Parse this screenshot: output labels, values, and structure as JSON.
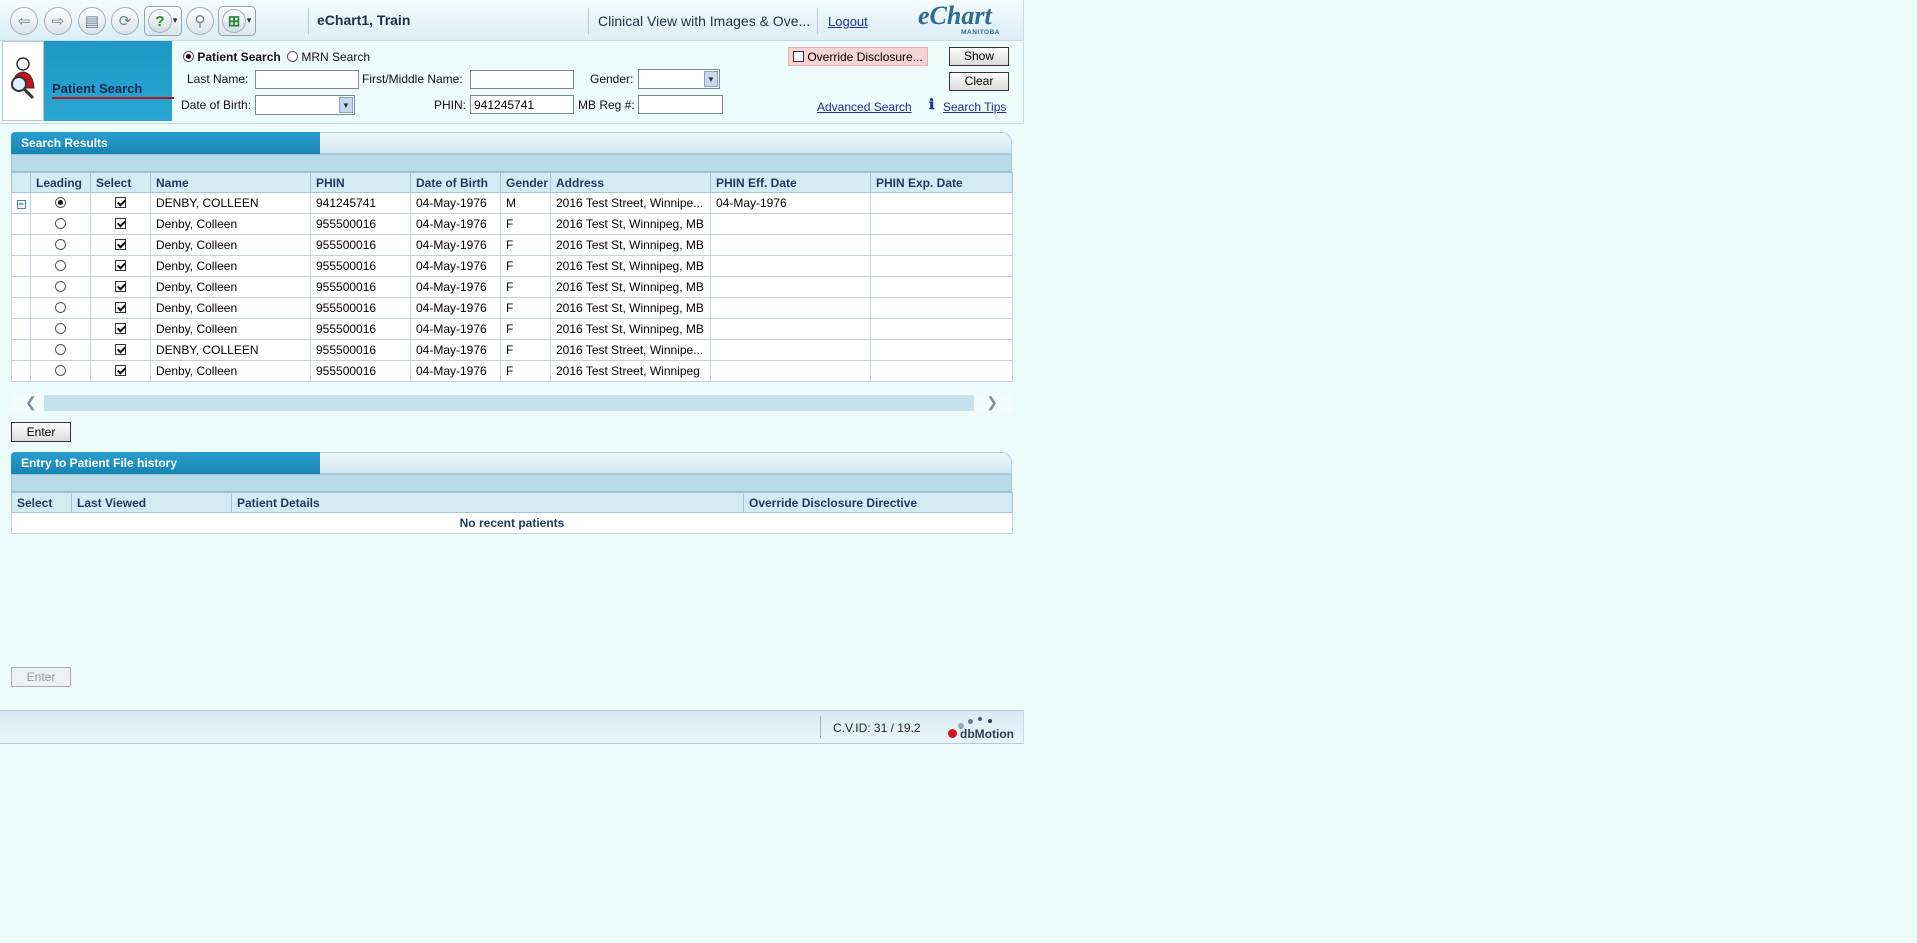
{
  "toolbar": {
    "title": "eChart1, Train",
    "clinical_view": "Clinical View with Images & Ove...",
    "logout": "Logout",
    "logo_main": "eChart",
    "logo_sub": "MANITOBA"
  },
  "search": {
    "heading": "Patient Search",
    "mode_patient": "Patient Search",
    "mode_mrn": "MRN Search",
    "last_name_label": "Last Name:",
    "last_name_value": "",
    "first_name_label": "First/Middle Name:",
    "first_name_value": "",
    "gender_label": "Gender:",
    "gender_value": "",
    "dob_label": "Date of Birth:",
    "dob_value": "",
    "phin_label": "PHIN:",
    "phin_value": "941245741",
    "mbreg_label": "MB Reg #:",
    "mbreg_value": "",
    "override_label": "Override Disclosure...",
    "show_label": "Show",
    "clear_label": "Clear",
    "advanced_link": "Advanced Search",
    "tips_link": "Search Tips"
  },
  "results": {
    "title": "Search Results",
    "columns": [
      "Leading",
      "Select",
      "Name",
      "PHIN",
      "Date of Birth",
      "Gender",
      "Address",
      "PHIN Eff. Date",
      "PHIN Exp. Date"
    ],
    "rows": [
      {
        "name": "DENBY, COLLEEN",
        "phin": "941245741",
        "dob": "04-May-1976",
        "gender": "M",
        "address": "2016 Test Street, Winnipe...",
        "eff": "04-May-1976",
        "exp": "",
        "leading": true
      },
      {
        "name": "Denby, Colleen",
        "phin": "955500016",
        "dob": "04-May-1976",
        "gender": "F",
        "address": "2016 Test St, Winnipeg, MB",
        "eff": "",
        "exp": "",
        "leading": false
      },
      {
        "name": "Denby, Colleen",
        "phin": "955500016",
        "dob": "04-May-1976",
        "gender": "F",
        "address": "2016 Test St, Winnipeg, MB",
        "eff": "",
        "exp": "",
        "leading": false
      },
      {
        "name": "Denby, Colleen",
        "phin": "955500016",
        "dob": "04-May-1976",
        "gender": "F",
        "address": "2016 Test St, Winnipeg, MB",
        "eff": "",
        "exp": "",
        "leading": false
      },
      {
        "name": "Denby, Colleen",
        "phin": "955500016",
        "dob": "04-May-1976",
        "gender": "F",
        "address": "2016 Test St, Winnipeg, MB",
        "eff": "",
        "exp": "",
        "leading": false
      },
      {
        "name": "Denby, Colleen",
        "phin": "955500016",
        "dob": "04-May-1976",
        "gender": "F",
        "address": "2016 Test St, Winnipeg, MB",
        "eff": "",
        "exp": "",
        "leading": false
      },
      {
        "name": "Denby, Colleen",
        "phin": "955500016",
        "dob": "04-May-1976",
        "gender": "F",
        "address": "2016 Test St, Winnipeg, MB",
        "eff": "",
        "exp": "",
        "leading": false
      },
      {
        "name": "DENBY, COLLEEN",
        "phin": "955500016",
        "dob": "04-May-1976",
        "gender": "F",
        "address": "2016 Test Street, Winnipe...",
        "eff": "",
        "exp": "",
        "leading": false
      },
      {
        "name": "Denby, Colleen",
        "phin": "955500016",
        "dob": "04-May-1976",
        "gender": "F",
        "address": "2016 Test Street, Winnipeg",
        "eff": "",
        "exp": "",
        "leading": false
      }
    ],
    "enter_label": "Enter"
  },
  "history": {
    "title": "Entry to Patient File history",
    "columns": [
      "Select",
      "Last Viewed",
      "Patient Details",
      "Override Disclosure Directive"
    ],
    "empty_message": "No recent patients",
    "enter_label": "Enter"
  },
  "footer": {
    "cvid": "C.V.ID: 31 / 19.2",
    "brand": "dbMotion"
  },
  "icons": {
    "back": "back-arrow-icon",
    "forward": "forward-arrow-icon",
    "print": "print-icon",
    "refresh": "refresh-icon",
    "help": "help-icon",
    "search": "magnifier-icon",
    "add": "add-window-icon",
    "tips": "info-icon"
  },
  "colors": {
    "page_bg": "#eefbfb",
    "panel_header": "#1d97c6",
    "link": "#1a2fa0",
    "override_bg": "#f8d3d3"
  }
}
